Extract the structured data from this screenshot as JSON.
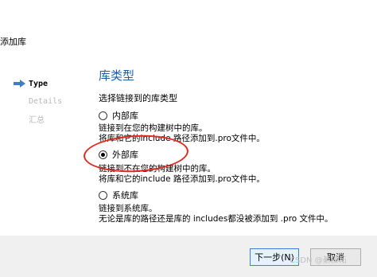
{
  "window": {
    "title": "添加库"
  },
  "sidebar": {
    "items": [
      {
        "label": "Type",
        "active": true
      },
      {
        "label": "Details",
        "active": false
      },
      {
        "label": "汇总",
        "active": false
      }
    ]
  },
  "main": {
    "title": "库类型",
    "question": "选择链接到的库类型",
    "options": [
      {
        "label": "内部库",
        "checked": false,
        "desc_line1": "链接到在您的构建树中的库。",
        "desc_line2": "将库和它的include 路径添加到.pro文件中。"
      },
      {
        "label": "外部库",
        "checked": true,
        "desc_line1": "链接到不在您的构建树中的库。",
        "desc_line2": "将库和它的include 路径添加到.pro文件中。"
      },
      {
        "label": "系统库",
        "checked": false,
        "desc_line1": "链接到系统库。",
        "desc_line2": "无论是库的路径还是库的 includes都没被添加到 .pro 文件中。"
      }
    ]
  },
  "footer": {
    "next_label": "下一步(N)",
    "cancel_label": "取消"
  },
  "watermark": "CSDN @綦操祏",
  "colors": {
    "title": "#1b5fa8",
    "highlight": "#e02a1f",
    "arrow": "#3f7cc9"
  }
}
